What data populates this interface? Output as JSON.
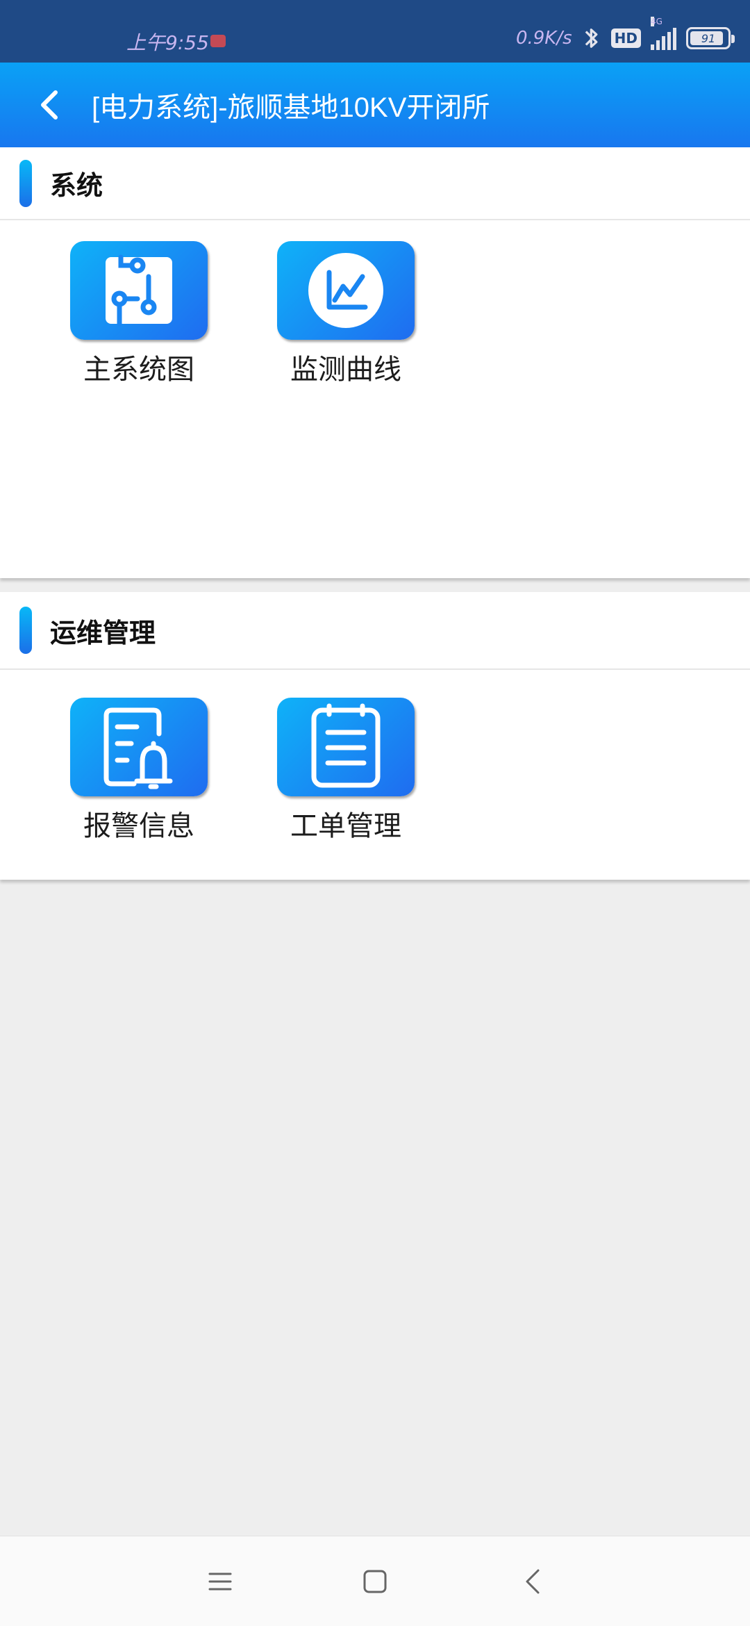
{
  "status_bar": {
    "time": "上午9:55",
    "net_speed": "0.9K/s",
    "hd_badge": "HD",
    "signal_label": "4G",
    "battery_level": 91,
    "battery_text": "91"
  },
  "header": {
    "title": "[电力系统]-旅顺基地10KV开闭所"
  },
  "sections": [
    {
      "title": "系统",
      "tiles": [
        {
          "label": "主系统图",
          "icon": "circuit-diagram-icon"
        },
        {
          "label": "监测曲线",
          "icon": "line-chart-icon"
        }
      ]
    },
    {
      "title": "运维管理",
      "tiles": [
        {
          "label": "报警信息",
          "icon": "alarm-document-icon"
        },
        {
          "label": "工单管理",
          "icon": "work-order-icon"
        }
      ]
    }
  ],
  "nav_bar": {
    "menu_icon": "menu-icon",
    "home_icon": "home-square-icon",
    "back_icon": "back-chevron-icon"
  },
  "colors": {
    "status_bar_bg": "#1f4a86",
    "header_gradient_top": "#0aa1f6",
    "header_gradient_bottom": "#1877ef",
    "tile_gradient_start": "#0fb2f8",
    "tile_gradient_end": "#1f6cf0",
    "page_bg": "#eeeeee"
  }
}
